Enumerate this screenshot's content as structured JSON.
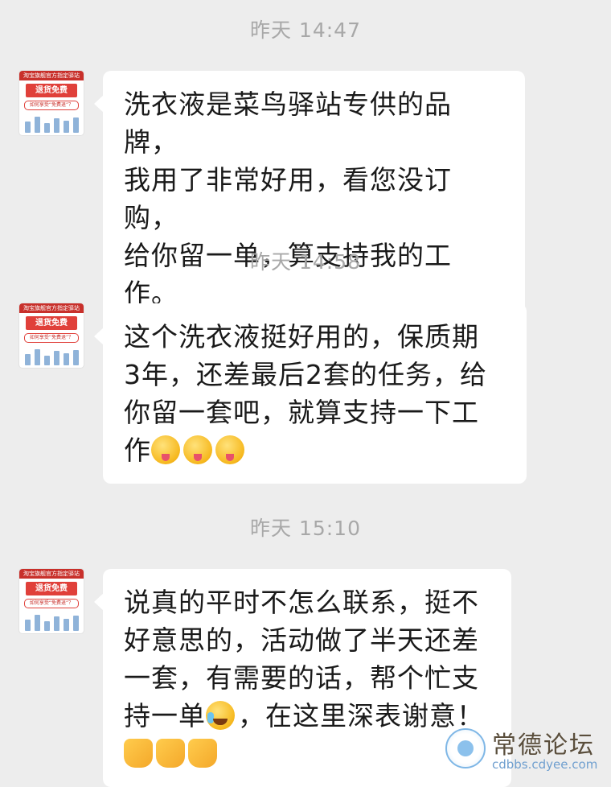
{
  "avatar": {
    "banner_text": "淘宝旗舰官方指定驿站",
    "promo_text": "退货免费",
    "sub_text": "如何享受“免费退”？"
  },
  "messages": [
    {
      "timestamp": "昨天 14:47",
      "lines": [
        "洗衣液是菜鸟驿站专供的品牌，",
        "我用了非常好用，看您没订购，",
        "给你留一单，算支持我的工作。"
      ]
    },
    {
      "timestamp": "昨天 14:58",
      "lines": [
        "这个洗衣液挺好用的，保质期",
        "3年，还差最后2套的任务，给",
        "你留一套吧，就算支持一下工",
        "作"
      ],
      "trailing_emojis": [
        "wink-tongue-emoji",
        "wink-tongue-emoji",
        "wink-tongue-emoji"
      ]
    },
    {
      "timestamp": "昨天 15:10",
      "lines": [
        "说真的平时不怎么联系，挺不",
        "好意思的，活动做了半天还差",
        "一套，有需要的话，帮个忙支",
        "持一单",
        "，在这里深表谢意！"
      ],
      "inline_emoji": "loudly-crying-emoji",
      "trailing_emojis": [
        "handshake-emoji",
        "handshake-emoji",
        "handshake-emoji"
      ]
    }
  ],
  "watermark": {
    "title": "常德论坛",
    "url": "cdbbs.cdyee.com"
  }
}
